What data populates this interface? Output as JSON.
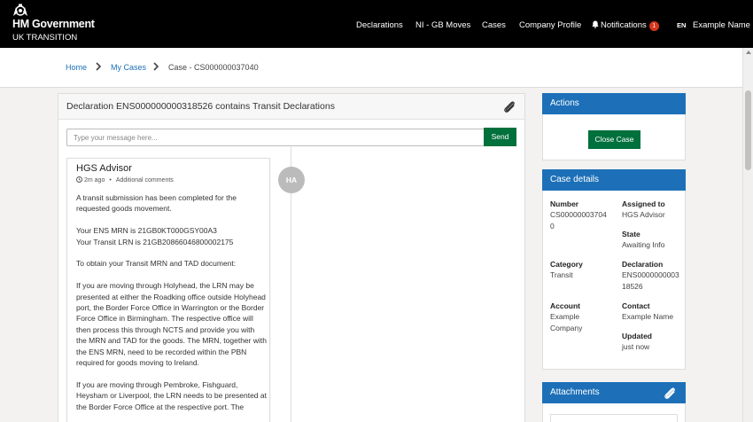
{
  "header": {
    "org_title": "HM Government",
    "org_subtitle": "UK TRANSITION",
    "nav": {
      "declarations": "Declarations",
      "ni_gb_moves": "NI - GB Moves",
      "cases": "Cases",
      "company_profile": "Company Profile",
      "notifications": "Notifications",
      "notifications_count": "1",
      "language": "EN",
      "user": "Example Name"
    }
  },
  "breadcrumb": {
    "home": "Home",
    "my_cases": "My Cases",
    "current": "Case - CS000000037040"
  },
  "conversation": {
    "title": "Declaration ENS000000000318526 contains Transit Declarations",
    "input_placeholder": "Type your message here...",
    "send_label": "Send",
    "message": {
      "author": "HGS Advisor",
      "avatar_initials": "HA",
      "time": "2m ago",
      "type": "Additional comments",
      "paragraphs": [
        "A transit submission has been completed for the requested goods movement.",
        "Your ENS MRN is 21GB0KT000GSY00A3\nYour Transit LRN is 21GB20866046800002175",
        "To obtain your Transit MRN and TAD document:",
        "If you are moving through Holyhead, the LRN may be presented at either the Roadking office outside Holyhead port, the Border Force Office in Warrington or the Border Force Office in Birmingham. The respective office will then process this through NCTS and provide you with the MRN and TAD for the goods. The MRN, together with the ENS MRN, need to be recorded within the PBN required for goods moving to Ireland.",
        "If you are moving through Pembroke, Fishguard, Heysham or Liverpool, the LRN needs to be presented at the Border Force Office at the respective port. The"
      ]
    }
  },
  "actions": {
    "title": "Actions",
    "close_case": "Close Case"
  },
  "case_details": {
    "title": "Case details",
    "number_label": "Number",
    "number_value": "CS000000037040",
    "assigned_label": "Assigned to",
    "assigned_value": "HGS Advisor",
    "state_label": "State",
    "state_value": "Awaiting Info",
    "category_label": "Category",
    "category_value": "Transit",
    "declaration_label": "Declaration",
    "declaration_value": "ENS000000000318526",
    "account_label": "Account",
    "account_value": "Example Company",
    "contact_label": "Contact",
    "contact_value": "Example Name",
    "updated_label": "Updated",
    "updated_value": "just now"
  },
  "attachments": {
    "title": "Attachments"
  },
  "colors": {
    "header_bg": "#000000",
    "link": "#1d70b8",
    "panel_header": "#1d70b8",
    "button_green": "#00703c",
    "badge_red": "#d4351c"
  },
  "icons": [
    "crest-icon",
    "chevron-right-icon",
    "bell-icon",
    "paperclip-icon",
    "clock-icon"
  ]
}
